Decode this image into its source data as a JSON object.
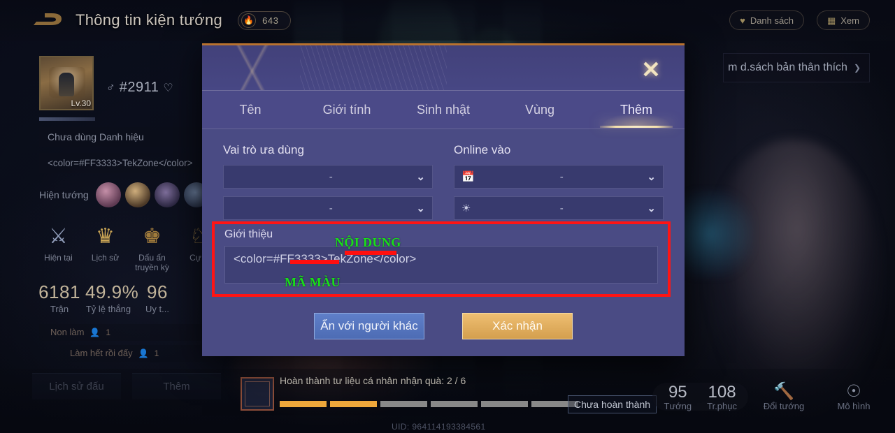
{
  "topbar": {
    "back_icon": "back-arrow-icon",
    "title": "Thông tin kiện tướng",
    "fire_icon": "fire-icon",
    "fire_count": "643",
    "list_icon": "heart-icon",
    "list_label": "Danh sách",
    "view_icon": "grid-icon",
    "view_label": "Xem"
  },
  "favorite_strip": {
    "label": "m d.sách bản thân thích",
    "chevron": "chevron-right-icon"
  },
  "profile": {
    "avatar_level": "Lv.30",
    "gender_icon": "male-symbol",
    "player_id": "#2911",
    "heart_icon": "heart-outline-icon",
    "title_row": "Chưa dùng Danh hiệu",
    "color_row": "<color=#FF3333>TekZone</color>",
    "hero_label": "Hiện tướng",
    "ranks": [
      {
        "icon": "rank-emblem-current",
        "label": "Hiện tại"
      },
      {
        "icon": "rank-emblem-history",
        "label": "Lịch sử"
      },
      {
        "icon": "rank-emblem-legend",
        "label": "Dấu ấn truyền kỳ"
      },
      {
        "icon": "rank-emblem-peak",
        "label": "Cự..."
      }
    ],
    "stats": [
      {
        "value": "6181",
        "label": "Trận"
      },
      {
        "value": "49.9%",
        "label": "Tỷ lệ thắng"
      },
      {
        "value": "96",
        "label": "Uy t..."
      }
    ],
    "notes": [
      {
        "text": "Non làm",
        "people_icon": "person-icon",
        "count": "1"
      },
      {
        "text": "Làm hết rồi đấy",
        "people_icon": "person-icon",
        "count": "1"
      }
    ],
    "buttons": [
      {
        "label": "Lịch sử đấu"
      },
      {
        "label": "Thêm"
      }
    ]
  },
  "bottombar": {
    "quest_icon": "quest-frame-icon",
    "quest_text": "Hoàn thành tư liệu cá nhân nhận quà: 2 / 6",
    "segments_total": 6,
    "segments_filled": 2,
    "incomplete_label": "Chưa hoàn thành",
    "uid": "UID: 964114193384561",
    "stats": [
      {
        "value": "95",
        "label": "Tướng"
      },
      {
        "value": "108",
        "label": "Tr.phục"
      }
    ],
    "icons": [
      {
        "icon": "swap-hero-icon",
        "label": "Đổi tướng"
      },
      {
        "icon": "model-icon",
        "label": "Mô hình"
      }
    ]
  },
  "modal": {
    "close_icon": "close-icon",
    "tabs": [
      {
        "label": "Tên",
        "active": false
      },
      {
        "label": "Giới tính",
        "active": false
      },
      {
        "label": "Sinh nhật",
        "active": false
      },
      {
        "label": "Vùng",
        "active": false
      },
      {
        "label": "Thêm",
        "active": true
      }
    ],
    "role_label": "Vai trò ưa dùng",
    "role_select_1": "-",
    "role_select_2": "-",
    "online_label": "Online vào",
    "online_icon_1": "calendar-icon",
    "online_select_1": "-",
    "online_icon_2": "sun-icon",
    "online_select_2": "-",
    "intro_label": "Giới thiệu",
    "intro_value": "<color=#FF3333>TekZone</color>",
    "annotation_content": "NỘI DUNG",
    "annotation_colorcode": "MÃ MÀU",
    "btn_hide": "Ẩn với người khác",
    "btn_confirm": "Xác nhận",
    "chevron_icon": "chevron-down-icon"
  },
  "colors": {
    "highlight_box": "#FF1414",
    "annotation_green": "#18E018",
    "annotation_red": "#FF0F0F",
    "modal_body": "#4A4B84",
    "modal_top_border": "#B8722F",
    "confirm_button": "#D49F4E",
    "hide_button": "#4D6CB4",
    "progress_fill": "#F0A93C",
    "tab_underline": "#F6E2AE"
  }
}
